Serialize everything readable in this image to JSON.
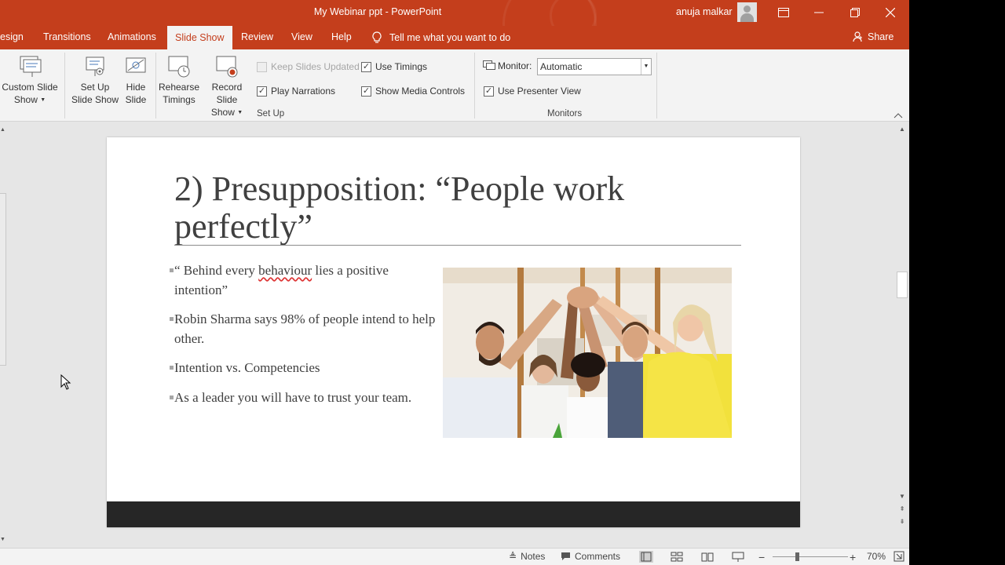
{
  "window": {
    "title": "My Webinar ppt  -  PowerPoint",
    "user": "anuja malkar",
    "accent": "#c43e1c"
  },
  "tabs": [
    {
      "label": "esign"
    },
    {
      "label": "Transitions"
    },
    {
      "label": "Animations"
    },
    {
      "label": "Slide Show",
      "active": true
    },
    {
      "label": "Review"
    },
    {
      "label": "View"
    },
    {
      "label": "Help"
    }
  ],
  "tell_me": "Tell me what you want to do",
  "share_label": "Share",
  "ribbon": {
    "custom_slide_show": {
      "line1": "Custom Slide",
      "line2": "Show"
    },
    "set_up_slide_show": {
      "line1": "Set Up",
      "line2": "Slide Show"
    },
    "hide_slide": {
      "line1": "Hide",
      "line2": "Slide"
    },
    "rehearse_timings": {
      "line1": "Rehearse",
      "line2": "Timings"
    },
    "record_slide_show": {
      "line1": "Record Slide",
      "line2": "Show"
    },
    "keep_slides_updated": {
      "label": "Keep Slides Updated",
      "checked": false,
      "disabled": true
    },
    "play_narrations": {
      "label": "Play Narrations",
      "checked": true
    },
    "use_timings": {
      "label": "Use Timings",
      "checked": true
    },
    "show_media_controls": {
      "label": "Show Media Controls",
      "checked": true
    },
    "setup_group_label": "Set Up",
    "monitor_label": "Monitor:",
    "monitor_value": "Automatic",
    "use_presenter_view": {
      "label": "Use Presenter View",
      "checked": true
    },
    "monitors_group_label": "Monitors"
  },
  "slide": {
    "title": "2) Presupposition: “People work perfectly”",
    "bullets": [
      {
        "before": "“ Behind every ",
        "underlined": "behaviour",
        "after": " lies a positive intention”"
      },
      {
        "before": "Robin Sharma says 98% of people intend to help other.",
        "underlined": "",
        "after": ""
      },
      {
        "before": "Intention vs. Competencies",
        "underlined": "",
        "after": ""
      },
      {
        "before": "As a leader you will have to trust your team.",
        "underlined": "",
        "after": ""
      }
    ],
    "image_alt": "team-high-five-photo"
  },
  "statusbar": {
    "notes_label": "Notes",
    "comments_label": "Comments",
    "zoom": "70%",
    "zoom_fraction": 0.3
  }
}
